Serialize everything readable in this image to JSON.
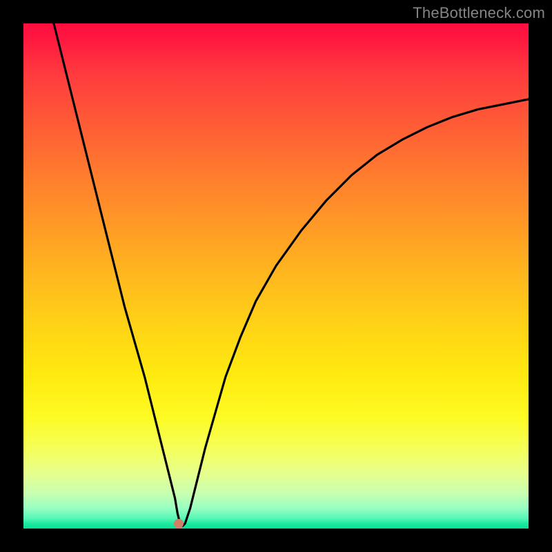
{
  "watermark": "TheBottleneck.com",
  "dot": {
    "x_pct": 30.7,
    "y_pct": 99.1
  },
  "chart_data": {
    "type": "line",
    "title": "",
    "xlabel": "",
    "ylabel": "",
    "xlim": [
      0,
      100
    ],
    "ylim": [
      0,
      100
    ],
    "grid": false,
    "legend": false,
    "background_gradient": {
      "orientation": "vertical",
      "stops": [
        {
          "pos": 0,
          "color": "#ff0d3f"
        },
        {
          "pos": 50,
          "color": "#ffc81a"
        },
        {
          "pos": 80,
          "color": "#fbff40"
        },
        {
          "pos": 100,
          "color": "#07e094"
        }
      ]
    },
    "series": [
      {
        "name": "bottleneck-curve",
        "x": [
          6,
          8,
          10,
          12,
          14,
          16,
          18,
          20,
          22,
          24,
          26,
          27,
          28,
          29,
          30,
          30.5,
          31,
          31.5,
          32,
          33,
          34,
          36,
          38,
          40,
          43,
          46,
          50,
          55,
          60,
          65,
          70,
          75,
          80,
          85,
          90,
          95,
          100
        ],
        "y": [
          100,
          92,
          84,
          76,
          68,
          60,
          52,
          44,
          37,
          30,
          22,
          18,
          14,
          10,
          6,
          3,
          1,
          0.5,
          1,
          4,
          8,
          16,
          23,
          30,
          38,
          45,
          52,
          59,
          65,
          70,
          74,
          77,
          79.5,
          81.5,
          83,
          84,
          85
        ]
      }
    ],
    "marker": {
      "x": 30.7,
      "y": 0.9,
      "color": "#d08068"
    }
  }
}
